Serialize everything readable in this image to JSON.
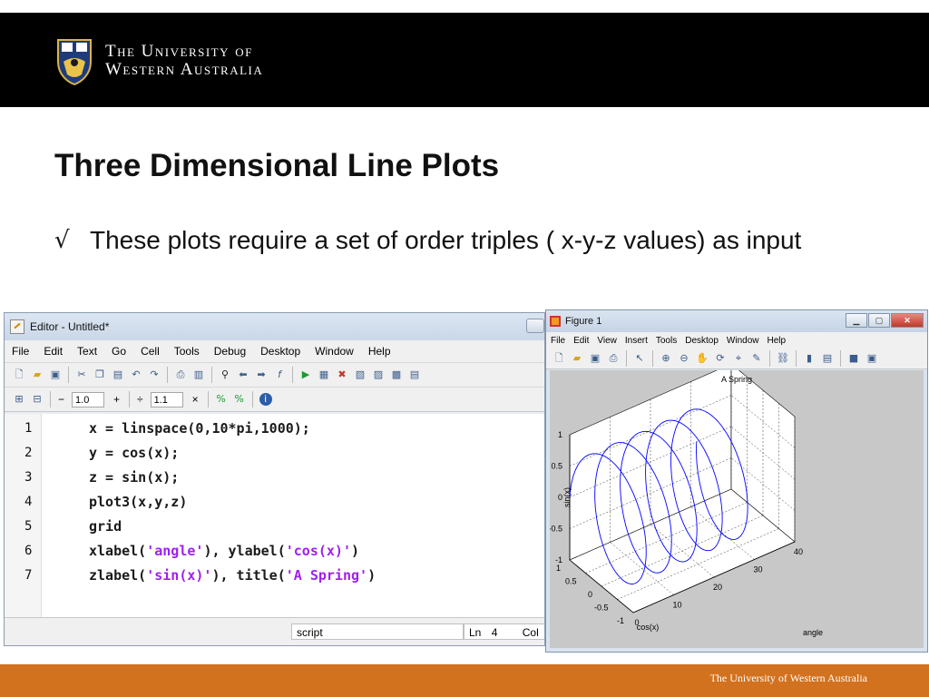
{
  "header": {
    "university_line1": "The University of",
    "university_line2": "Western Australia"
  },
  "slide": {
    "title": "Three Dimensional Line Plots",
    "bullet_symbol": "√",
    "bullet_text": "These plots require a set of order triples ( x-y-z values) as input"
  },
  "footer": {
    "text": "The University of Western Australia"
  },
  "editor": {
    "title": "Editor - Untitled*",
    "menu": [
      "File",
      "Edit",
      "Text",
      "Go",
      "Cell",
      "Tools",
      "Debug",
      "Desktop",
      "Window",
      "Help"
    ],
    "cell_minus": "−",
    "cell_value1": "1.0",
    "cell_plus": "+",
    "cell_div": "÷",
    "cell_value2": "1.1",
    "cell_times": "×",
    "line_numbers": [
      "1",
      "2",
      "3",
      "4",
      "5",
      "6",
      "7"
    ],
    "code": [
      {
        "pre": "x = linspace(0,10*pi,1000);",
        "str1": "",
        "mid": "",
        "str2": "",
        "post": ""
      },
      {
        "pre": "y = cos(x);",
        "str1": "",
        "mid": "",
        "str2": "",
        "post": ""
      },
      {
        "pre": "z = sin(x);",
        "str1": "",
        "mid": "",
        "str2": "",
        "post": ""
      },
      {
        "pre": "plot3(x,y,z)",
        "str1": "",
        "mid": "",
        "str2": "",
        "post": ""
      },
      {
        "pre": "grid",
        "str1": "",
        "mid": "",
        "str2": "",
        "post": ""
      },
      {
        "pre": "xlabel(",
        "str1": "'angle'",
        "mid": "), ylabel(",
        "str2": "'cos(x)'",
        "post": ")"
      },
      {
        "pre": "zlabel(",
        "str1": "'sin(x)'",
        "mid": "), title(",
        "str2": "'A Spring'",
        "post": ")"
      }
    ],
    "status_mode": "script",
    "status_ln_label": "Ln",
    "status_ln_value": "4",
    "status_col_label": "Col"
  },
  "figure": {
    "title": "Figure 1",
    "menu": [
      "File",
      "Edit",
      "View",
      "Insert",
      "Tools",
      "Desktop",
      "Window",
      "Help"
    ]
  },
  "chart_data": {
    "type": "line",
    "title": "A Spring",
    "xlabel": "angle",
    "ylabel": "cos(x)",
    "zlabel": "sin(x)",
    "xlim": [
      0,
      40
    ],
    "ylim": [
      -1,
      1
    ],
    "zlim": [
      -1,
      1
    ],
    "x_ticks": [
      "0",
      "10",
      "20",
      "30",
      "40"
    ],
    "y_ticks": [
      "-1",
      "-0.5",
      "0",
      "0.5",
      "1"
    ],
    "z_ticks": [
      "-1",
      "-0.5",
      "0",
      "0.5",
      "1"
    ],
    "grid": true,
    "series": [
      {
        "x": {
          "start": 0,
          "end": 31.4159,
          "points": 1000
        },
        "y": "cos(x)",
        "z": "sin(x)",
        "color": "#0000ff"
      }
    ]
  }
}
